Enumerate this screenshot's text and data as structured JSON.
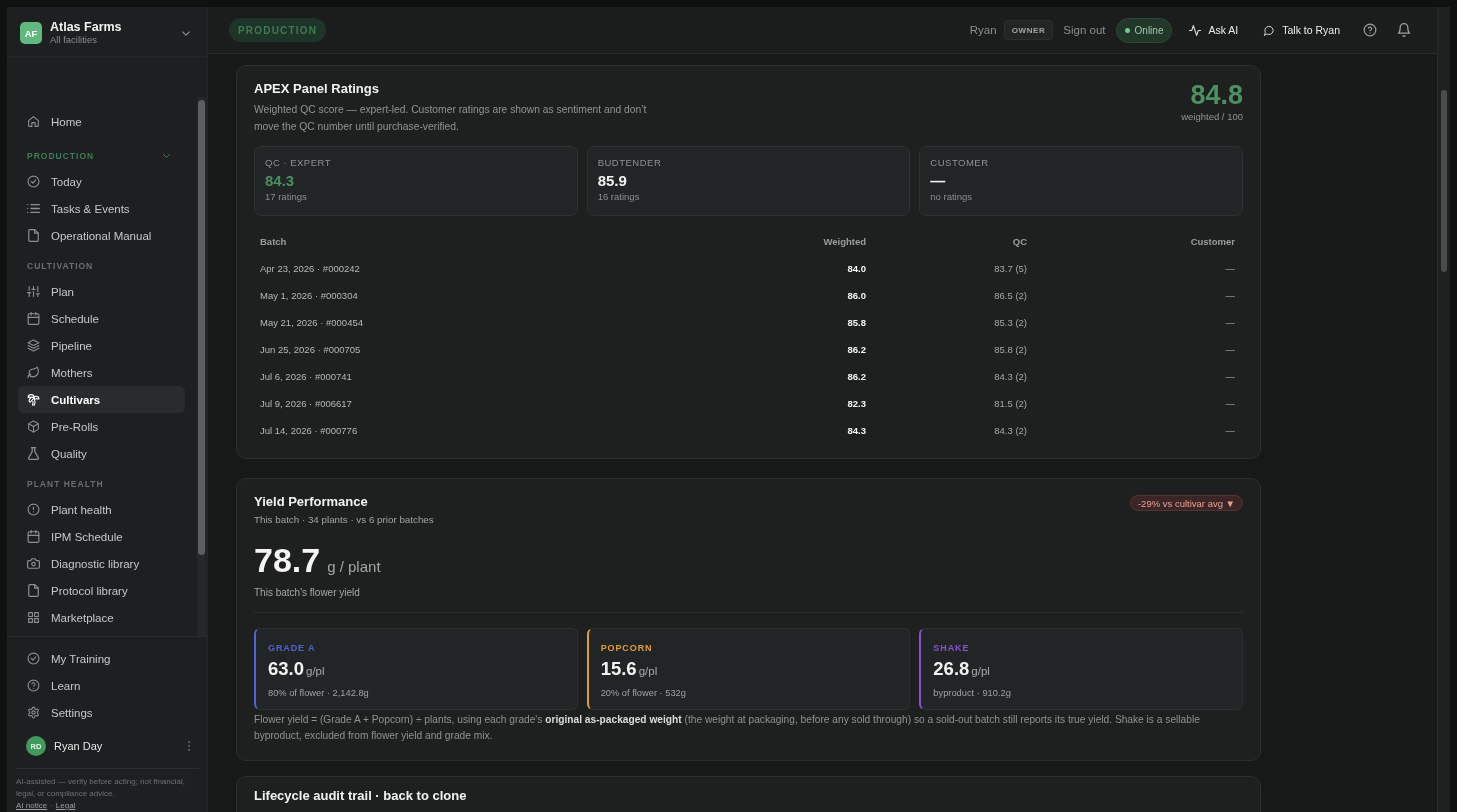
{
  "brand": {
    "initials": "AF",
    "name": "Atlas Farms",
    "subtitle": "All facilities"
  },
  "sidebar": {
    "home": {
      "label": "Home",
      "selected": false
    },
    "sections": [
      {
        "title": "PRODUCTION",
        "active": true,
        "items": [
          {
            "label": "Today",
            "selected": false
          },
          {
            "label": "Tasks & Events",
            "selected": false
          },
          {
            "label": "Operational Manual",
            "selected": false
          }
        ]
      },
      {
        "title": "CULTIVATION",
        "active": false,
        "items": [
          {
            "label": "Plan",
            "selected": false
          },
          {
            "label": "Schedule",
            "selected": false
          },
          {
            "label": "Pipeline",
            "selected": false
          },
          {
            "label": "Mothers",
            "selected": false
          },
          {
            "label": "Cultivars",
            "selected": true
          },
          {
            "label": "Pre-Rolls",
            "selected": false
          },
          {
            "label": "Quality",
            "selected": false
          }
        ]
      },
      {
        "title": "PLANT HEALTH",
        "active": false,
        "items": [
          {
            "label": "Plant health",
            "selected": false
          },
          {
            "label": "IPM Schedule",
            "selected": false
          },
          {
            "label": "Diagnostic library",
            "selected": false
          },
          {
            "label": "Protocol library",
            "selected": false
          },
          {
            "label": "Marketplace",
            "selected": false
          }
        ]
      }
    ],
    "footer_items": [
      {
        "label": "My Training",
        "selected": false
      },
      {
        "label": "Learn",
        "selected": false
      },
      {
        "label": "Settings",
        "selected": false
      }
    ],
    "user": {
      "initials": "RD",
      "name": "Ryan Day"
    },
    "disclaimer": "AI-assisted — verify before acting; not financial, legal, or compliance advice.",
    "legal_links": [
      "AI notice",
      "Legal"
    ],
    "legal_separator": "·"
  },
  "topbar": {
    "context": "PRODUCTION",
    "user_name": "Ryan",
    "role": "OWNER",
    "sign_out": "Sign out",
    "status": {
      "label": "Online",
      "online": true
    },
    "actions": [
      "Ask AI",
      "Talk to Ryan"
    ]
  },
  "ratings_panel": {
    "title": "APEX Panel Ratings",
    "description": "Weighted QC score — expert-led. Customer ratings are shown as sentiment and don’t move the QC number until purchase-verified.",
    "score": "84.8",
    "score_caption": "weighted / 100",
    "stats": [
      {
        "label": "QC · EXPERT",
        "value": "84.3",
        "count": "17 ratings",
        "highlight": true
      },
      {
        "label": "BUDTENDER",
        "value": "85.9",
        "count": "16 ratings",
        "highlight": false
      },
      {
        "label": "CUSTOMER",
        "value": "—",
        "count": "no ratings",
        "highlight": false
      }
    ],
    "table": {
      "columns": [
        "Batch",
        "Weighted",
        "QC",
        "Customer"
      ],
      "rows": [
        [
          "Apr 23, 2026 · #000242",
          "84.0",
          "83.7 (5)",
          "—"
        ],
        [
          "May 1, 2026 · #000304",
          "86.0",
          "86.5 (2)",
          "—"
        ],
        [
          "May 21, 2026 · #000454",
          "85.8",
          "85.3 (2)",
          "—"
        ],
        [
          "Jun 25, 2026 · #000705",
          "86.2",
          "85.8 (2)",
          "—"
        ],
        [
          "Jul 6, 2026 · #000741",
          "86.2",
          "84.3 (2)",
          "—"
        ],
        [
          "Jul 9, 2026 · #006617",
          "82.3",
          "81.5 (2)",
          "—"
        ],
        [
          "Jul 14, 2026 · #000776",
          "84.3",
          "84.3 (2)",
          "—"
        ]
      ]
    }
  },
  "yield_panel": {
    "title": "Yield Performance",
    "subtitle": "This batch · 34 plants · vs 6 prior batches",
    "trend_badge": {
      "text": "-29% vs cultivar avg ▼",
      "negative": true
    },
    "value": "78.7",
    "unit": "g / plant",
    "caption": "This batch's flower yield",
    "grades": [
      {
        "label": "GRADE A",
        "value": "63.0",
        "unit": "g/pl",
        "detail": "80% of flower · 2,142.8g",
        "color": "#4f63d8"
      },
      {
        "label": "POPCORN",
        "value": "15.6",
        "unit": "g/pl",
        "detail": "20% of flower · 532g",
        "color": "#e39b3a"
      },
      {
        "label": "SHAKE",
        "value": "26.8",
        "unit": "g/pl",
        "detail": "byproduct · 910.2g",
        "color": "#8a4fd6"
      }
    ],
    "footnote": "Flower yield = (Grade A + Popcorn) ÷ plants, using each grade's **original as-packaged weight** (the weight at packaging, before any sold through) so a sold-out batch still reports its true yield. Shake is a sellable byproduct, excluded from flower yield and grade mix."
  },
  "lifecycle_panel": {
    "title": "Lifecycle audit trail · back to clone"
  }
}
